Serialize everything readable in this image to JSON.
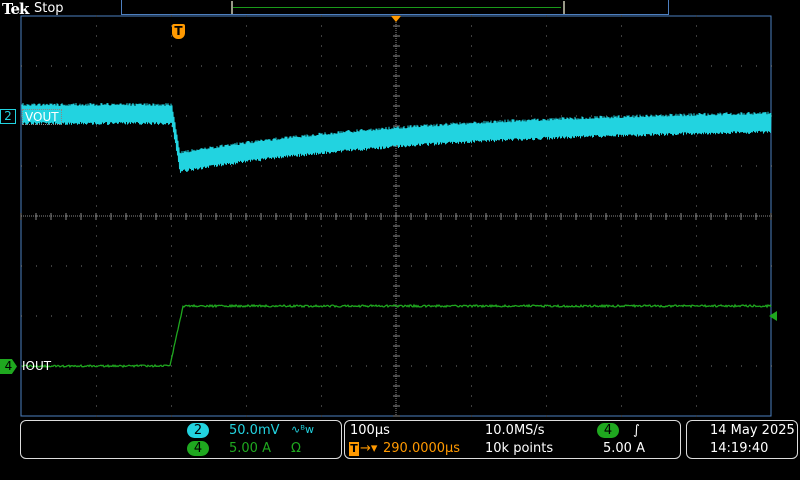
{
  "header": {
    "brand": "Tek",
    "status": "Stop"
  },
  "trigger_marker": "T",
  "channels": [
    {
      "id": "2",
      "label": "VOUT",
      "color": "#22d3e0",
      "scale": "50.0mV",
      "extra": "∿ᴮw"
    },
    {
      "id": "4",
      "label": "IOUT",
      "color": "#1fa81f",
      "scale": "5.00 A",
      "extra": "Ω"
    }
  ],
  "horizontal": {
    "timebase": "100µs",
    "delay": "290.0000µs",
    "sample_rate": "10.0MS/s",
    "record_length": "10k points"
  },
  "trigger": {
    "source": "4",
    "slope": "∫",
    "level": "5.00 A",
    "color": "#ff9900"
  },
  "datetime": {
    "date": "14 May 2025",
    "time": "14:19:40"
  }
}
